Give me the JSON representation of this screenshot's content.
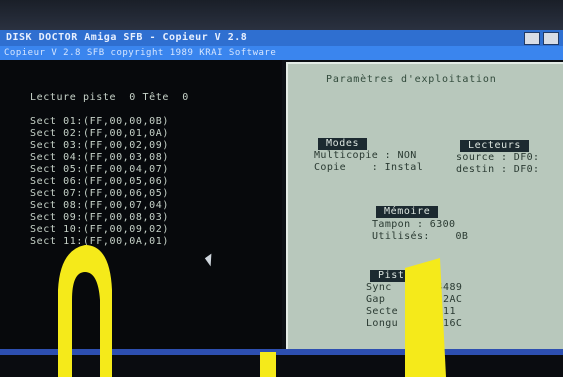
{
  "window": {
    "title": "DISK DOCTOR Amiga  SFB - Copieur V 2.8",
    "subtitle": "Copieur V 2.8  SFB  copyright 1989 KRAI Software"
  },
  "left_pane": {
    "header": "Lecture piste  0 Tête  0",
    "sectors": [
      "Sect 01:(FF,00,00,0B)",
      "Sect 02:(FF,00,01,0A)",
      "Sect 03:(FF,00,02,09)",
      "Sect 04:(FF,00,03,08)",
      "Sect 05:(FF,00,04,07)",
      "Sect 06:(FF,00,05,06)",
      "Sect 07:(FF,00,06,05)",
      "Sect 08:(FF,00,07,04)",
      "Sect 09:(FF,00,08,03)",
      "Sect 10:(FF,00,09,02)",
      "Sect 11:(FF,00,0A,01)"
    ]
  },
  "dialog": {
    "title": "Paramètres d'exploitation",
    "modes": {
      "header": "Modes",
      "line1": "Multicopie : NON",
      "line2": "Copie    : Instal"
    },
    "lecteurs": {
      "header": "Lecteurs",
      "line1": "source : DF0:",
      "line2": "destin : DF0:"
    },
    "memoire": {
      "header": "Mémoire",
      "line1": "Tampon : 6300",
      "line2": "Utilisés:    0B"
    },
    "piste": {
      "header": "Piste",
      "line1": "Sync    : $4489",
      "line2": "Gap     : $02AC",
      "line3": "Secte   :   11",
      "line4": "Longu   : $316C"
    }
  },
  "colors": {
    "title_bar": "#2f6fd0",
    "dialog_bg": "#b8c8bc",
    "overlay_yellow": "#f5ea1a"
  }
}
